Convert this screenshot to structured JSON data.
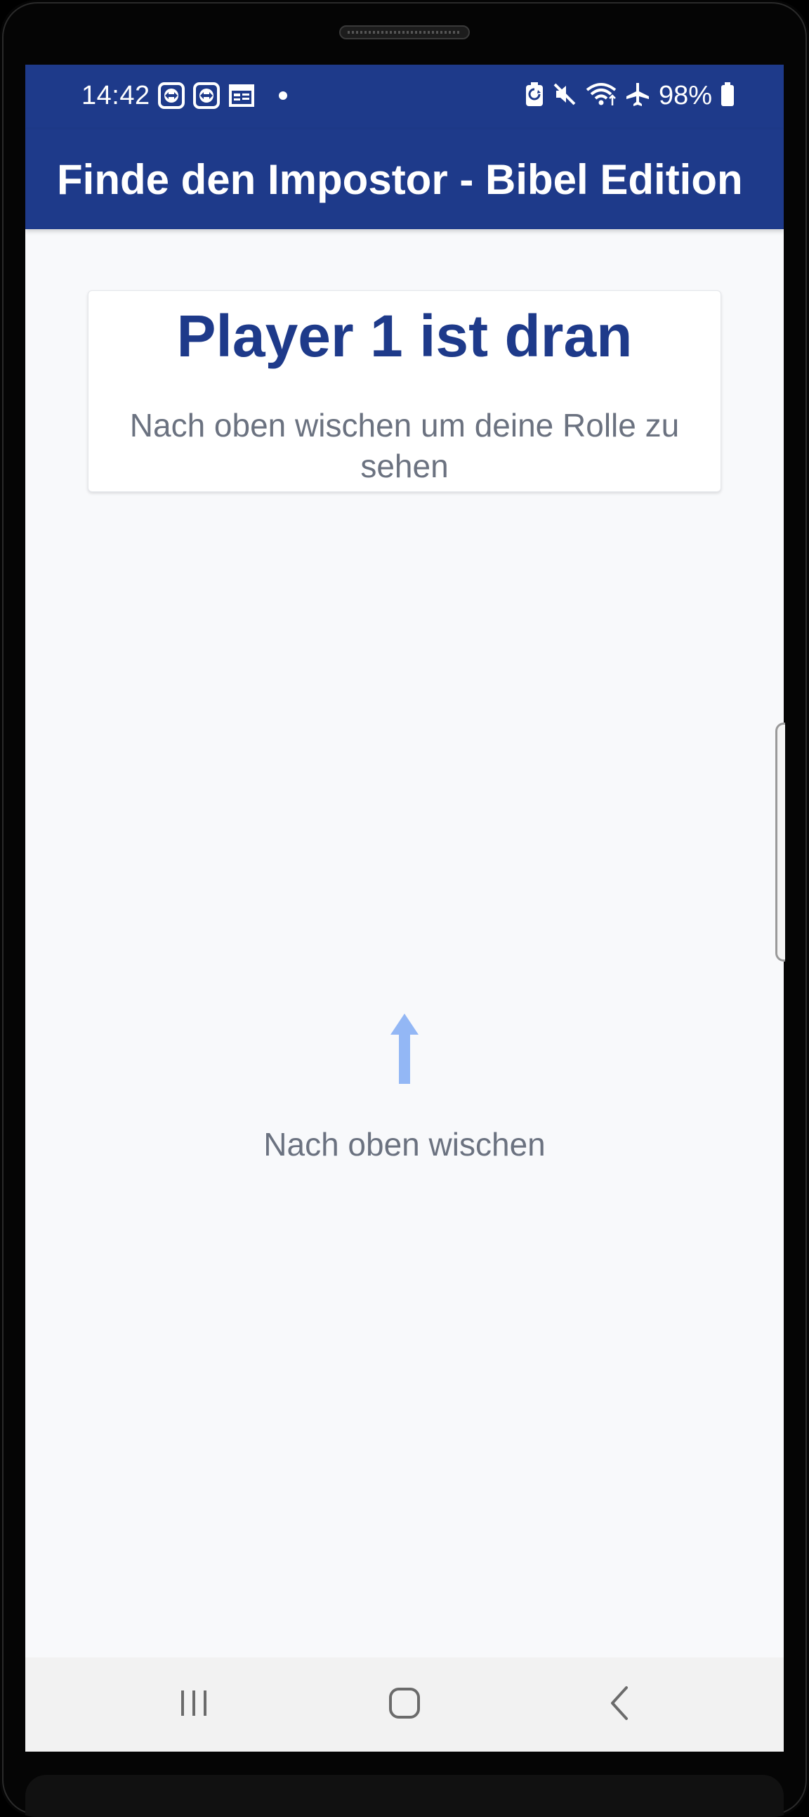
{
  "status_bar": {
    "time": "14:42",
    "left_icons": [
      "teamviewer-icon",
      "teamviewer-icon",
      "calendar-icon",
      "notification-dot-icon"
    ],
    "right_icons": [
      "battery-saver-icon",
      "mute-icon",
      "wifi-icon",
      "airplane-icon"
    ],
    "battery_percent": "98%",
    "battery_level": 0.98
  },
  "app_bar": {
    "title": "Finde den Impostor - Bibel Edition"
  },
  "player_card": {
    "turn_text": "Player 1 ist dran",
    "instruction": "Nach oben wischen um deine Rolle zu sehen"
  },
  "swipe": {
    "icon": "arrow-up-icon",
    "label": "Nach oben wischen"
  },
  "nav_bar": {
    "buttons": [
      "recent-apps-icon",
      "home-icon",
      "back-icon"
    ]
  },
  "colors": {
    "primary": "#1e3a8a",
    "background": "#f8f9fb",
    "card": "#ffffff",
    "muted_text": "#6b7280",
    "arrow": "#93b7f5",
    "nav_bar": "#f2f2f2"
  }
}
